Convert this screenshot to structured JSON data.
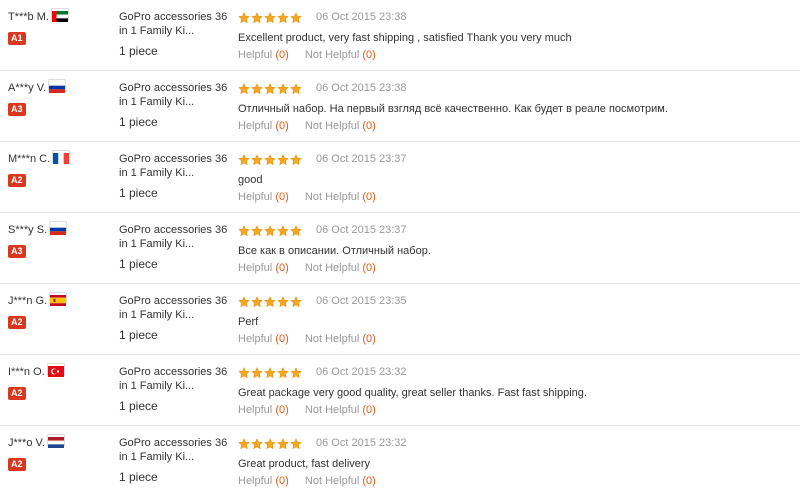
{
  "colors": {
    "star": "#f5a623",
    "star_edge": "#e08a00",
    "badge": "#d9381e",
    "count": "#e25c17"
  },
  "helpful_label": "Helpful",
  "not_helpful_label": "Not Helpful",
  "reviews": [
    {
      "name": "T***b M.",
      "flag": "ae",
      "level": "A1",
      "product_line1": "GoPro accessories 36",
      "product_line2": "in 1 Family Ki...",
      "quantity": "1 piece",
      "date": "06 Oct 2015 23:38",
      "comment": "Excellent product, very fast shipping , satisfied Thank you very much",
      "helpful": "(0)",
      "not_helpful": "(0)"
    },
    {
      "name": "A***y V.",
      "flag": "ru",
      "level": "A3",
      "product_line1": "GoPro accessories 36",
      "product_line2": "in 1 Family Ki...",
      "quantity": "1 piece",
      "date": "06 Oct 2015 23:38",
      "comment": "Отличный набор. На первый взгляд всё качественно. Как будет в реале посмотрим.",
      "helpful": "(0)",
      "not_helpful": "(0)"
    },
    {
      "name": "M***n C.",
      "flag": "fr",
      "level": "A2",
      "product_line1": "GoPro accessories 36",
      "product_line2": "in 1 Family Ki...",
      "quantity": "1 piece",
      "date": "06 Oct 2015 23:37",
      "comment": "good",
      "helpful": "(0)",
      "not_helpful": "(0)"
    },
    {
      "name": "S***y S.",
      "flag": "ru",
      "level": "A3",
      "product_line1": "GoPro accessories 36",
      "product_line2": "in 1 Family Ki...",
      "quantity": "1 piece",
      "date": "06 Oct 2015 23:37",
      "comment": "Все как в описании. Отличный набор.",
      "helpful": "(0)",
      "not_helpful": "(0)"
    },
    {
      "name": "J***n G.",
      "flag": "es",
      "level": "A2",
      "product_line1": "GoPro accessories 36",
      "product_line2": "in 1 Family Ki...",
      "quantity": "1 piece",
      "date": "06 Oct 2015 23:35",
      "comment": "Perf",
      "helpful": "(0)",
      "not_helpful": "(0)"
    },
    {
      "name": "I***n O.",
      "flag": "tr",
      "level": "A2",
      "product_line1": "GoPro accessories 36",
      "product_line2": "in 1 Family Ki...",
      "quantity": "1 piece",
      "date": "06 Oct 2015 23:32",
      "comment": "Great package very good quality, great seller thanks. Fast fast shipping.",
      "helpful": "(0)",
      "not_helpful": "(0)"
    },
    {
      "name": "J***o V.",
      "flag": "nl",
      "level": "A2",
      "product_line1": "GoPro accessories 36",
      "product_line2": "in 1 Family Ki...",
      "quantity": "1 piece",
      "date": "06 Oct 2015 23:32",
      "comment": "Great product, fast delivery",
      "helpful": "(0)",
      "not_helpful": "(0)"
    }
  ]
}
